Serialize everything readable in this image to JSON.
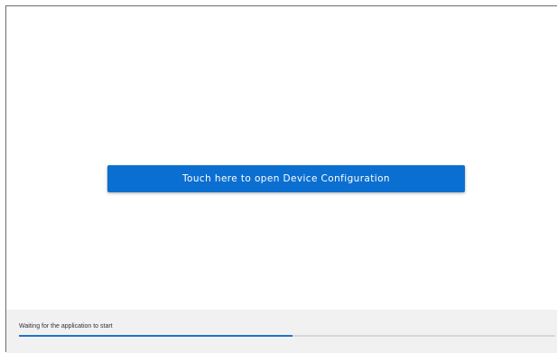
{
  "main": {
    "button_label": "Touch here to open Device Configuration"
  },
  "status": {
    "message": "Waiting for the application to start",
    "progress_fraction": 0.51
  },
  "colors": {
    "button_background": "#0b6fd1",
    "button_text": "#ffffff",
    "status_panel_background": "#f1f1f1",
    "progress_fill": "#1f73cc",
    "progress_track": "#d6d6d6"
  }
}
